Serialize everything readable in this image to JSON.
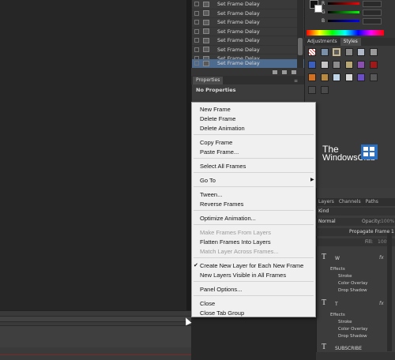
{
  "frames_panel": {
    "rows": [
      {
        "label": "Set Frame Delay",
        "selected": false
      },
      {
        "label": "Set Frame Delay",
        "selected": false
      },
      {
        "label": "Set Frame Delay",
        "selected": false
      },
      {
        "label": "Set Frame Delay",
        "selected": false
      },
      {
        "label": "Set Frame Delay",
        "selected": false
      },
      {
        "label": "Set Frame Delay",
        "selected": false
      },
      {
        "label": "Set Frame Delay",
        "selected": false
      },
      {
        "label": "Set Frame Delay",
        "selected": true
      }
    ]
  },
  "color_panel": {
    "r_label": "R",
    "g_label": "G",
    "b_label": "B"
  },
  "adjustments_panel": {
    "tabs": [
      "Adjustments",
      "Styles"
    ]
  },
  "properties_panel": {
    "tab": "Properties",
    "empty_text": "No Properties"
  },
  "logo": {
    "line1": "The",
    "line2": "WindowsClub"
  },
  "layers_panel": {
    "tabs": [
      "Layers",
      "Channels",
      "Paths"
    ],
    "kind_label": "Kind",
    "blend_mode": "Normal",
    "opacity_label": "Opacity:",
    "opacity_value": "100%",
    "propagate_label": "Propagate Frame 1",
    "fill_label": "Fill:",
    "fill_value": "100%",
    "layers": [
      {
        "name": "W",
        "effects_label": "Effects",
        "effects": [
          "Stroke",
          "Color Overlay",
          "Drop Shadow"
        ]
      },
      {
        "name": "T",
        "effects_label": "Effects",
        "effects": [
          "Stroke",
          "Color Overlay",
          "Drop Shadow"
        ]
      },
      {
        "name": "SUBSCRIBE",
        "effects_label": "",
        "effects": []
      }
    ]
  },
  "context_menu": {
    "new_frame": "New Frame",
    "delete_frame": "Delete Frame",
    "delete_animation": "Delete Animation",
    "copy_frame": "Copy Frame",
    "paste_frame": "Paste Frame...",
    "select_all_frames": "Select All Frames",
    "go_to": "Go To",
    "tween": "Tween...",
    "reverse_frames": "Reverse Frames",
    "optimize_animation": "Optimize Animation...",
    "make_frames_from_layers": "Make Frames From Layers",
    "flatten_frames_into_layers": "Flatten Frames Into Layers",
    "match_layer_across_frames": "Match Layer Across Frames...",
    "create_new_layer": "Create New Layer for Each New Frame",
    "new_layers_visible": "New Layers Visible in All Frames",
    "panel_options": "Panel Options...",
    "close": "Close",
    "close_tab_group": "Close Tab Group"
  }
}
